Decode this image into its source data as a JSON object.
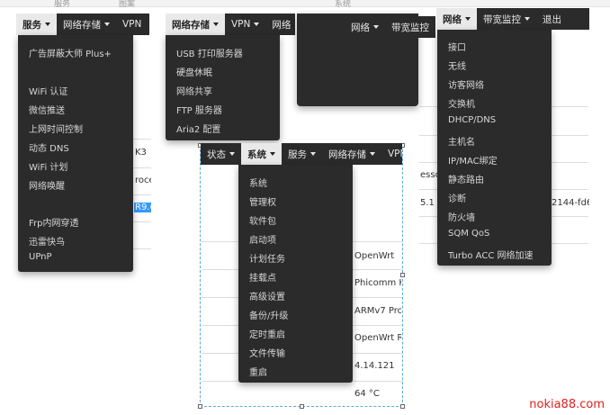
{
  "top_strip": [
    "服务",
    "图案",
    "系统"
  ],
  "background": {
    "left_table": [
      "K3",
      "roce",
      "R9.6"
    ],
    "middle_table": [
      "OpenWrt",
      "Phicomm K",
      "ARMv7 Proc",
      "OpenWrt R",
      "4.14.121",
      "64 °C"
    ],
    "right_table": [
      "esso",
      "5.1",
      "2144-fd6f"
    ]
  },
  "shot1": {
    "nav": [
      {
        "label": "服务",
        "active": true
      },
      {
        "label": "网络存储",
        "active": false
      },
      {
        "label": "VPN",
        "active": false
      }
    ],
    "items": [
      "广告屏蔽大师 Plus+",
      "",
      "WiFi 认证",
      "微信推送",
      "上网时间控制",
      "动态 DNS",
      "WiFi 计划",
      "网络唤醒",
      "",
      "Frp内网穿透",
      "迅雷快鸟",
      "UPnP"
    ]
  },
  "shot2": {
    "nav": [
      {
        "label": "网络存储",
        "active": true
      },
      {
        "label": "VPN",
        "active": false
      },
      {
        "label": "网络",
        "active": false
      }
    ],
    "items": [
      "USB 打印服务器",
      "硬盘休眠",
      "网络共享",
      "FTP 服务器",
      "Aria2 配置"
    ]
  },
  "shot3": {
    "nav": [
      {
        "label": "网络",
        "active": false
      },
      {
        "label": "带宽监控",
        "active": false
      }
    ]
  },
  "shot4": {
    "nav": [
      {
        "label": "网络",
        "active": true
      },
      {
        "label": "带宽监控",
        "active": false
      },
      {
        "label": "退出",
        "active": false
      }
    ],
    "items": [
      "接口",
      "无线",
      "访客网络",
      "交换机",
      "DHCP/DNS",
      "主机名",
      "IP/MAC绑定",
      "静态路由",
      "诊断",
      "防火墙",
      "SQM QoS",
      "Turbo ACC 网络加速"
    ]
  },
  "shot5": {
    "nav": [
      {
        "label": "状态",
        "active": false
      },
      {
        "label": "系统",
        "active": true
      },
      {
        "label": "服务",
        "active": false
      },
      {
        "label": "网络存储",
        "active": false
      },
      {
        "label": "VPN",
        "active": false
      }
    ],
    "items": [
      "系统",
      "管理权",
      "软件包",
      "启动项",
      "计划任务",
      "挂载点",
      "高级设置",
      "备份/升级",
      "定时重启",
      "文件传输",
      "重启"
    ]
  },
  "watermark": "nokia88.com",
  "colors": {
    "menu_bg": "#2b2b2b",
    "menu_text": "#d7d7d7",
    "active_bg": "#e9e9e9",
    "selection_blue": "#5ba6e6",
    "watermark": "#e02020"
  }
}
